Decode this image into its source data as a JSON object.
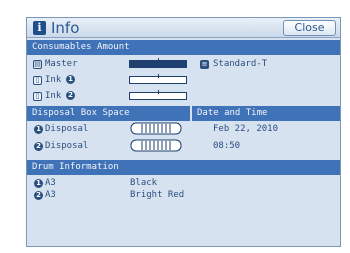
{
  "header": {
    "title": "Info",
    "close_label": "Close"
  },
  "consumables": {
    "section_title": "Consumables Amount",
    "master": {
      "label": "Master",
      "level": 1.0,
      "type_value": "Standard-T"
    },
    "ink1": {
      "label": "Ink",
      "level": 0.0
    },
    "ink2": {
      "label": "Ink",
      "level": 0.0
    }
  },
  "disposal": {
    "section_title": "Disposal Box Space",
    "items": [
      {
        "label": "Disposal"
      },
      {
        "label": "Disposal"
      }
    ]
  },
  "datetime": {
    "section_title": "Date and Time",
    "date": "Feb 22, 2010",
    "time": "08:50"
  },
  "drum": {
    "section_title": "Drum Information",
    "items": [
      {
        "size": "A3",
        "color": "Black"
      },
      {
        "size": "A3",
        "color": "Bright Red"
      }
    ]
  },
  "colors": {
    "accent": "#3f72b6",
    "panel": "#d6e2ef",
    "text": "#2b4f80"
  }
}
